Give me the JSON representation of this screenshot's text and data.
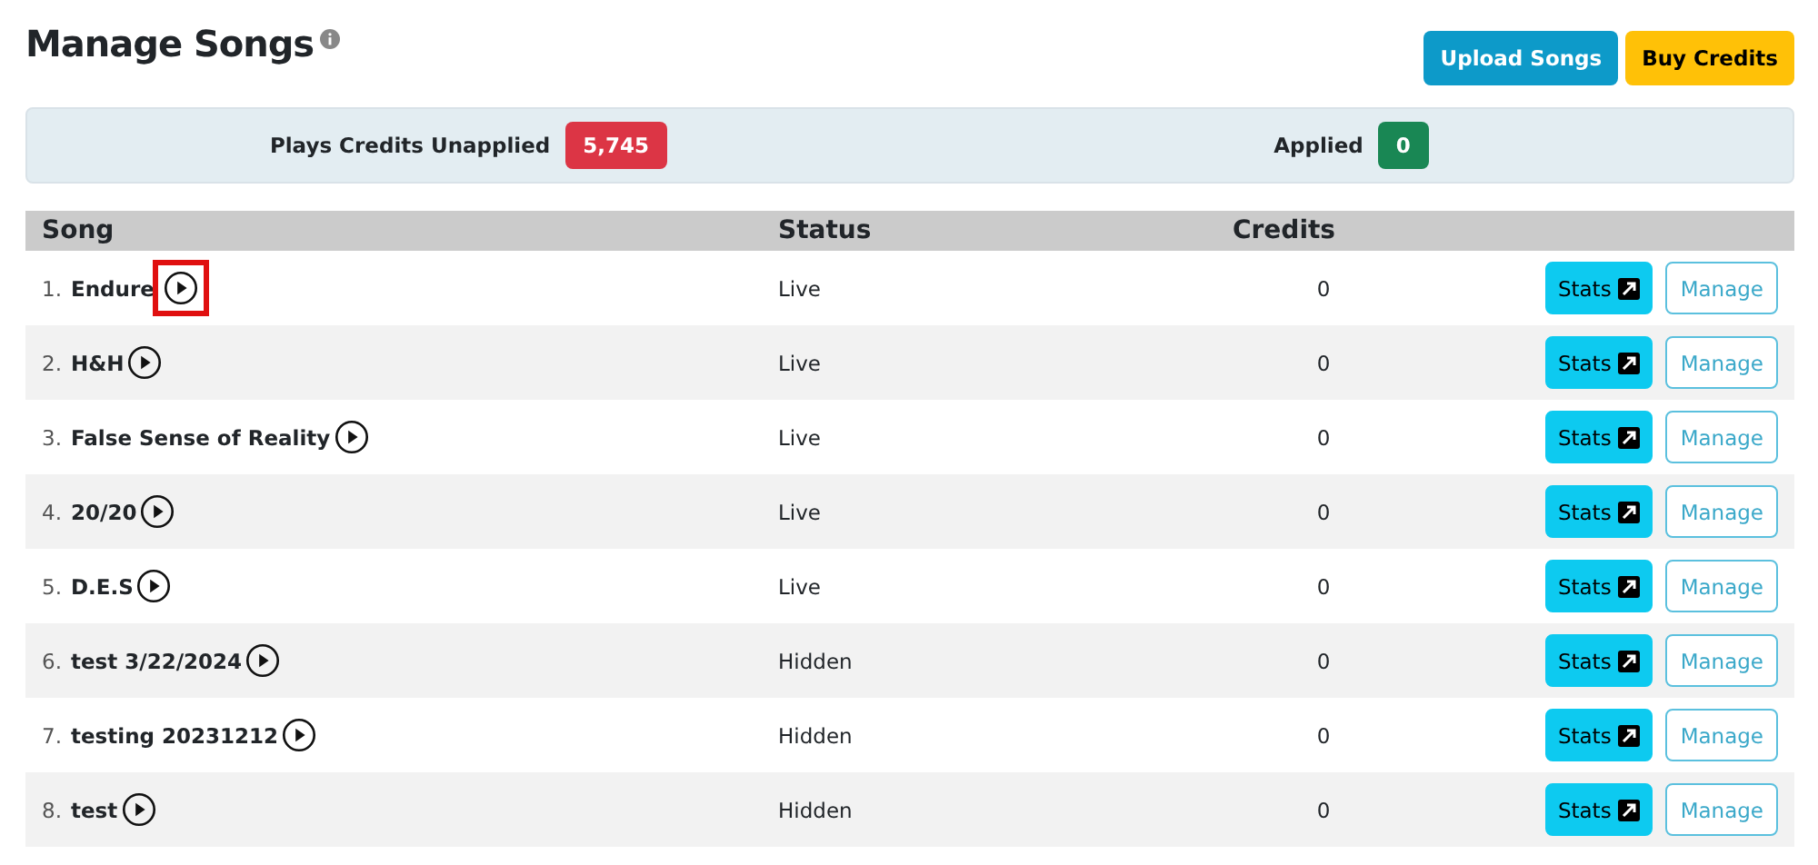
{
  "title": "Manage Songs",
  "actions": [
    {
      "label": "Upload Songs",
      "kind": "primary"
    },
    {
      "label": "Buy Credits",
      "kind": "warning"
    }
  ],
  "summary": [
    {
      "label": "Plays Credits Unapplied",
      "value": "5,745",
      "color": "#dc3545"
    },
    {
      "label": "Applied",
      "value": "0",
      "color": "#198754"
    }
  ],
  "table": {
    "columns": [
      "Song",
      "Status",
      "Credits"
    ],
    "rows": [
      {
        "index": "1.",
        "name": "Endure",
        "status": "Live",
        "credits": "0",
        "stats": "Stats",
        "manage": "Manage",
        "highlighted": true
      },
      {
        "index": "2.",
        "name": "H&H",
        "status": "Live",
        "credits": "0",
        "stats": "Stats",
        "manage": "Manage",
        "highlighted": false
      },
      {
        "index": "3.",
        "name": "False Sense of Reality",
        "status": "Live",
        "credits": "0",
        "stats": "Stats",
        "manage": "Manage",
        "highlighted": false
      },
      {
        "index": "4.",
        "name": "20/20",
        "status": "Live",
        "credits": "0",
        "stats": "Stats",
        "manage": "Manage",
        "highlighted": false
      },
      {
        "index": "5.",
        "name": "D.E.S",
        "status": "Live",
        "credits": "0",
        "stats": "Stats",
        "manage": "Manage",
        "highlighted": false
      },
      {
        "index": "6.",
        "name": "test 3/22/2024",
        "status": "Hidden",
        "credits": "0",
        "stats": "Stats",
        "manage": "Manage",
        "highlighted": false
      },
      {
        "index": "7.",
        "name": "testing 20231212",
        "status": "Hidden",
        "credits": "0",
        "stats": "Stats",
        "manage": "Manage",
        "highlighted": false
      },
      {
        "index": "8.",
        "name": "test",
        "status": "Hidden",
        "credits": "0",
        "stats": "Stats",
        "manage": "Manage",
        "highlighted": false
      }
    ]
  }
}
